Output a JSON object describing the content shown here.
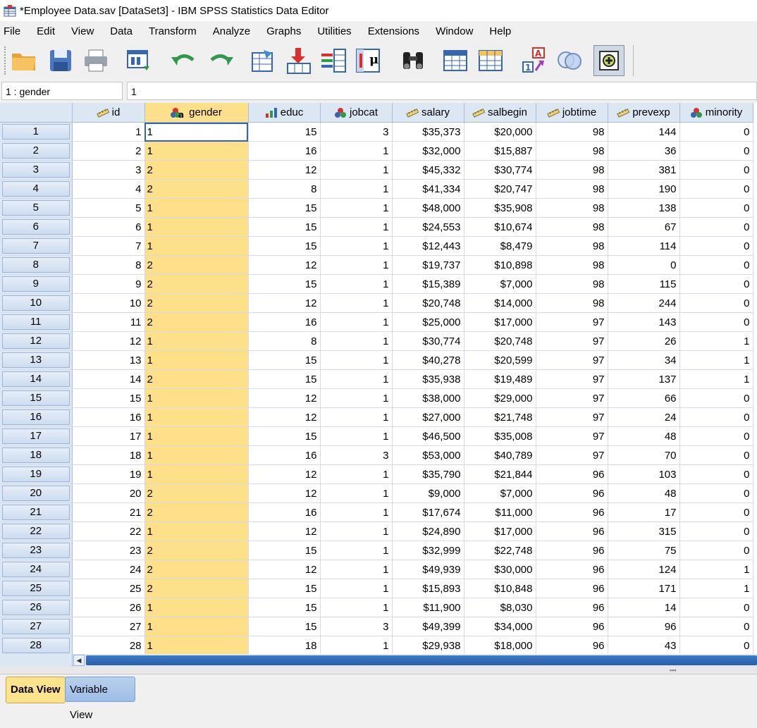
{
  "window": {
    "title": "*Employee Data.sav [DataSet3] - IBM SPSS Statistics Data Editor"
  },
  "menu": [
    "File",
    "Edit",
    "View",
    "Data",
    "Transform",
    "Analyze",
    "Graphs",
    "Utilities",
    "Extensions",
    "Window",
    "Help"
  ],
  "cellref": {
    "name": "1 : gender",
    "value": "1"
  },
  "toolbar": [
    {
      "name": "open-folder-icon"
    },
    {
      "name": "save-icon"
    },
    {
      "name": "print-icon"
    },
    {
      "name": "dialog-recall-icon"
    },
    {
      "name": "undo-icon"
    },
    {
      "name": "redo-icon"
    },
    {
      "name": "goto-case-icon"
    },
    {
      "name": "goto-variable-icon"
    },
    {
      "name": "variables-icon"
    },
    {
      "name": "run-descriptives-icon"
    },
    {
      "name": "find-icon"
    },
    {
      "name": "insert-cases-icon"
    },
    {
      "name": "insert-variable-icon"
    },
    {
      "name": "split-file-icon"
    },
    {
      "name": "select-cases-icon"
    },
    {
      "name": "value-labels-icon"
    },
    {
      "name": "use-variable-sets-icon"
    }
  ],
  "columns": [
    {
      "label": "id",
      "icon": "scale-icon"
    },
    {
      "label": "gender",
      "icon": "nominal-string-icon"
    },
    {
      "label": "educ",
      "icon": "ordinal-icon"
    },
    {
      "label": "jobcat",
      "icon": "nominal-icon"
    },
    {
      "label": "salary",
      "icon": "scale-icon"
    },
    {
      "label": "salbegin",
      "icon": "scale-icon"
    },
    {
      "label": "jobtime",
      "icon": "scale-icon"
    },
    {
      "label": "prevexp",
      "icon": "scale-icon"
    },
    {
      "label": "minority",
      "icon": "nominal-icon"
    }
  ],
  "rows": [
    [
      "1",
      "1",
      "1",
      "15",
      "3",
      "$35,373",
      "$20,000",
      "98",
      "144",
      "0"
    ],
    [
      "2",
      "2",
      "1",
      "16",
      "1",
      "$32,000",
      "$15,887",
      "98",
      "36",
      "0"
    ],
    [
      "3",
      "3",
      "2",
      "12",
      "1",
      "$45,332",
      "$30,774",
      "98",
      "381",
      "0"
    ],
    [
      "4",
      "4",
      "2",
      "8",
      "1",
      "$41,334",
      "$20,747",
      "98",
      "190",
      "0"
    ],
    [
      "5",
      "5",
      "1",
      "15",
      "1",
      "$48,000",
      "$35,908",
      "98",
      "138",
      "0"
    ],
    [
      "6",
      "6",
      "1",
      "15",
      "1",
      "$24,553",
      "$10,674",
      "98",
      "67",
      "0"
    ],
    [
      "7",
      "7",
      "1",
      "15",
      "1",
      "$12,443",
      "$8,479",
      "98",
      "114",
      "0"
    ],
    [
      "8",
      "8",
      "2",
      "12",
      "1",
      "$19,737",
      "$10,898",
      "98",
      "0",
      "0"
    ],
    [
      "9",
      "9",
      "2",
      "15",
      "1",
      "$15,389",
      "$7,000",
      "98",
      "115",
      "0"
    ],
    [
      "10",
      "10",
      "2",
      "12",
      "1",
      "$20,748",
      "$14,000",
      "98",
      "244",
      "0"
    ],
    [
      "11",
      "11",
      "2",
      "16",
      "1",
      "$25,000",
      "$17,000",
      "97",
      "143",
      "0"
    ],
    [
      "12",
      "12",
      "1",
      "8",
      "1",
      "$30,774",
      "$20,748",
      "97",
      "26",
      "1"
    ],
    [
      "13",
      "13",
      "1",
      "15",
      "1",
      "$40,278",
      "$20,599",
      "97",
      "34",
      "1"
    ],
    [
      "14",
      "14",
      "2",
      "15",
      "1",
      "$35,938",
      "$19,489",
      "97",
      "137",
      "1"
    ],
    [
      "15",
      "15",
      "1",
      "12",
      "1",
      "$38,000",
      "$29,000",
      "97",
      "66",
      "0"
    ],
    [
      "16",
      "16",
      "1",
      "12",
      "1",
      "$27,000",
      "$21,748",
      "97",
      "24",
      "0"
    ],
    [
      "17",
      "17",
      "1",
      "15",
      "1",
      "$46,500",
      "$35,008",
      "97",
      "48",
      "0"
    ],
    [
      "18",
      "18",
      "1",
      "16",
      "3",
      "$53,000",
      "$40,789",
      "97",
      "70",
      "0"
    ],
    [
      "19",
      "19",
      "1",
      "12",
      "1",
      "$35,790",
      "$21,844",
      "96",
      "103",
      "0"
    ],
    [
      "20",
      "20",
      "2",
      "12",
      "1",
      "$9,000",
      "$7,000",
      "96",
      "48",
      "0"
    ],
    [
      "21",
      "21",
      "2",
      "16",
      "1",
      "$17,674",
      "$11,000",
      "96",
      "17",
      "0"
    ],
    [
      "22",
      "22",
      "1",
      "12",
      "1",
      "$24,890",
      "$17,000",
      "96",
      "315",
      "0"
    ],
    [
      "23",
      "23",
      "2",
      "15",
      "1",
      "$32,999",
      "$22,748",
      "96",
      "75",
      "0"
    ],
    [
      "24",
      "24",
      "2",
      "12",
      "1",
      "$49,939",
      "$30,000",
      "96",
      "124",
      "1"
    ],
    [
      "25",
      "25",
      "2",
      "15",
      "1",
      "$15,893",
      "$10,848",
      "96",
      "171",
      "1"
    ],
    [
      "26",
      "26",
      "1",
      "15",
      "1",
      "$11,900",
      "$8,030",
      "96",
      "14",
      "0"
    ],
    [
      "27",
      "27",
      "1",
      "15",
      "3",
      "$49,399",
      "$34,000",
      "96",
      "96",
      "0"
    ],
    [
      "28",
      "28",
      "1",
      "18",
      "1",
      "$29,938",
      "$18,000",
      "96",
      "43",
      "0"
    ]
  ],
  "tabs": {
    "data_view": "Data View",
    "variable_view": "Variable View"
  },
  "colors": {
    "selected_column": "#ffe08a",
    "header_bg": "#dce7f4",
    "scroll_thumb": "#2a5fa8"
  }
}
